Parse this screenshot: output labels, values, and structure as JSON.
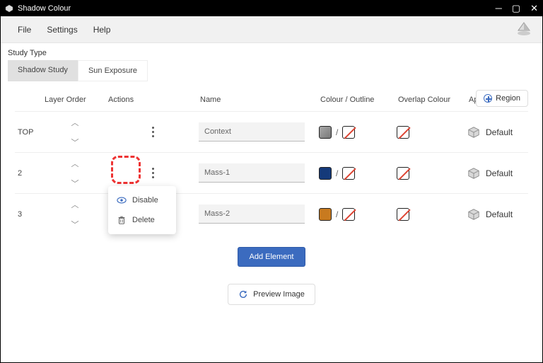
{
  "window": {
    "title": "Shadow Colour"
  },
  "menubar": {
    "file": "File",
    "settings": "Settings",
    "help": "Help"
  },
  "study_type": {
    "label": "Study Type",
    "tabs": [
      "Shadow Study",
      "Sun Exposure"
    ],
    "active": 0
  },
  "columns": {
    "layer_order": "Layer Order",
    "actions": "Actions",
    "name": "Name",
    "colour_outline": "Colour / Outline",
    "overlap_colour": "Overlap Colour",
    "appearance": "Appearance"
  },
  "region_button": "Region",
  "rows": [
    {
      "index": "TOP",
      "name": "Context",
      "colour": "grey",
      "outline": "none",
      "overlap": "none",
      "appearance": "Default"
    },
    {
      "index": "2",
      "name": "Mass-1",
      "colour": "navy",
      "outline": "none",
      "overlap": "none",
      "appearance": "Default"
    },
    {
      "index": "3",
      "name": "Mass-2",
      "colour": "orange",
      "outline": "none",
      "overlap": "none",
      "appearance": "Default"
    }
  ],
  "actions_menu": {
    "disable": "Disable",
    "delete": "Delete"
  },
  "buttons": {
    "add_element": "Add Element",
    "preview_image": "Preview Image"
  }
}
